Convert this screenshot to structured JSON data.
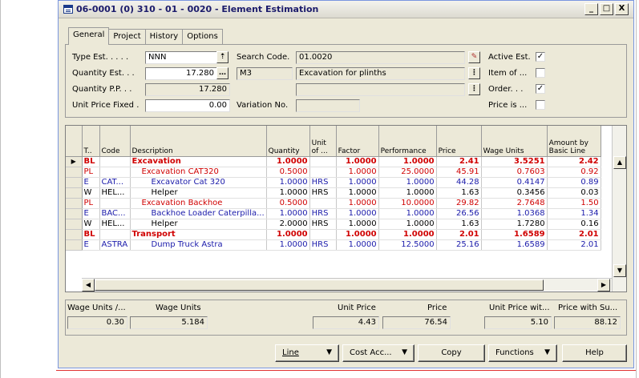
{
  "window": {
    "title": "06-0001 (0) 310 - 01 - 0020 - Element Estimation",
    "icon": "form-icon",
    "controls": [
      "_",
      "□",
      "X"
    ]
  },
  "tabs": [
    {
      "label": "General",
      "active": true
    },
    {
      "label": "Project",
      "active": false
    },
    {
      "label": "History",
      "active": false
    },
    {
      "label": "Options",
      "active": false
    }
  ],
  "general": {
    "type_est_label": "Type Est. . . . .",
    "type_est_value": "NNN",
    "quantity_est_label": "Quantity Est. . .",
    "quantity_est_value": "17.280",
    "quantity_pp_label": "Quantity P.P. . .",
    "quantity_pp_value": "17.280",
    "unit_price_fixed_label": "Unit Price Fixed .",
    "unit_price_fixed_value": "0.00",
    "search_code_label": "Search Code.",
    "search_code_value": "01.0020",
    "unit_value": "M3",
    "description_value": "Excavation for plinths",
    "variation_no_label": "Variation No.",
    "variation_no_value": "",
    "active_est_label": "Active Est.",
    "active_est_checked": true,
    "item_of_label": "Item of ...",
    "item_of_checked": false,
    "order_label": "Order. . .",
    "order_checked": true,
    "price_is_label": "Price is ...",
    "price_is_checked": false
  },
  "grid": {
    "columns": [
      "T..",
      "Code",
      "Description",
      "Quantity",
      "Unit of ...",
      "Factor",
      "Performance",
      "Price",
      "Wage Units",
      "Amount by Basic Line"
    ],
    "rows": [
      {
        "type": "BL",
        "code": "",
        "description": "Excavation",
        "quantity": "1.0000",
        "unit": "",
        "factor": "1.0000",
        "performance": "1.0000",
        "price": "2.41",
        "wage_units": "3.5251",
        "amount": "2.42",
        "selected": true,
        "indent": 0
      },
      {
        "type": "PL",
        "code": "",
        "description": "Excavation CAT320",
        "quantity": "0.5000",
        "unit": "",
        "factor": "1.0000",
        "performance": "25.0000",
        "price": "45.91",
        "wage_units": "0.7603",
        "amount": "0.92",
        "indent": 1
      },
      {
        "type": "E",
        "code": "CAT...",
        "description": "Excavator Cat 320",
        "quantity": "1.0000",
        "unit": "HRS",
        "factor": "1.0000",
        "performance": "1.0000",
        "price": "44.28",
        "wage_units": "0.4147",
        "amount": "0.89",
        "indent": 2
      },
      {
        "type": "W",
        "code": "HEL...",
        "description": "Helper",
        "quantity": "1.0000",
        "unit": "HRS",
        "factor": "1.0000",
        "performance": "1.0000",
        "price": "1.63",
        "wage_units": "0.3456",
        "amount": "0.03",
        "indent": 2
      },
      {
        "type": "PL",
        "code": "",
        "description": "Excavation Backhoe",
        "quantity": "0.5000",
        "unit": "",
        "factor": "1.0000",
        "performance": "10.0000",
        "price": "29.82",
        "wage_units": "2.7648",
        "amount": "1.50",
        "indent": 1
      },
      {
        "type": "E",
        "code": "BAC...",
        "description": "Backhoe Loader Caterpilla...",
        "quantity": "1.0000",
        "unit": "HRS",
        "factor": "1.0000",
        "performance": "1.0000",
        "price": "26.56",
        "wage_units": "1.0368",
        "amount": "1.34",
        "indent": 2
      },
      {
        "type": "W",
        "code": "HEL...",
        "description": "Helper",
        "quantity": "2.0000",
        "unit": "HRS",
        "factor": "1.0000",
        "performance": "1.0000",
        "price": "1.63",
        "wage_units": "1.7280",
        "amount": "0.16",
        "indent": 2
      },
      {
        "type": "BL",
        "code": "",
        "description": "Transport",
        "quantity": "1.0000",
        "unit": "",
        "factor": "1.0000",
        "performance": "1.0000",
        "price": "2.01",
        "wage_units": "1.6589",
        "amount": "2.01",
        "indent": 0
      },
      {
        "type": "E",
        "code": "ASTRA",
        "description": "Dump Truck Astra",
        "quantity": "1.0000",
        "unit": "HRS",
        "factor": "1.0000",
        "performance": "12.5000",
        "price": "25.16",
        "wage_units": "1.6589",
        "amount": "2.01",
        "indent": 2
      }
    ]
  },
  "totals": {
    "wage_units_per_label": "Wage Units /...",
    "wage_units_per_value": "0.30",
    "wage_units_label": "Wage Units",
    "wage_units_value": "5.184",
    "unit_price_label": "Unit Price",
    "unit_price_value": "4.43",
    "price_label": "Price",
    "price_value": "76.54",
    "unit_price_with_label": "Unit Price wit...",
    "unit_price_with_value": "5.10",
    "price_with_su_label": "Price with Su...",
    "price_with_su_value": "88.12"
  },
  "buttons": {
    "line": "Line",
    "cost_acc": "Cost Acc...",
    "copy": "Copy",
    "functions": "Functions",
    "help": "Help"
  }
}
